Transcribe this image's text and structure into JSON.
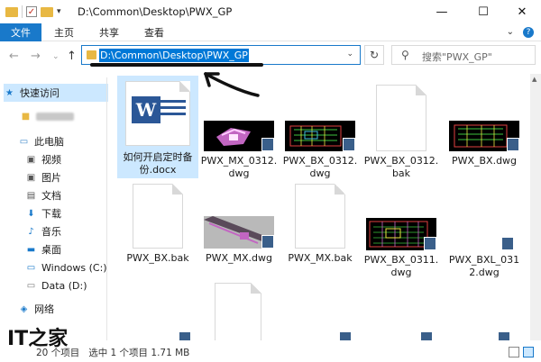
{
  "window": {
    "title": "D:\\Common\\Desktop\\PWX_GP",
    "controls": {
      "minimize": "—",
      "maximize": "☐",
      "close": "✕"
    }
  },
  "ribbon": {
    "tabs": [
      {
        "label": "文件",
        "active": true
      },
      {
        "label": "主页",
        "active": false
      },
      {
        "label": "共享",
        "active": false
      },
      {
        "label": "查看",
        "active": false
      }
    ],
    "expand": "⌄",
    "help": "?"
  },
  "nav": {
    "back": "←",
    "forward": "→",
    "recent": "⌄",
    "up": "↑",
    "address": "D:\\Common\\Desktop\\PWX_GP",
    "address_dropdown": "⌄",
    "refresh": "↻",
    "search_placeholder": "搜索\"PWX_GP\""
  },
  "sidebar": {
    "items": [
      {
        "label": "快速访问",
        "icon": "star-icon",
        "active": true
      },
      {
        "label": "",
        "icon": "user-icon",
        "active": false
      },
      {
        "label": "此电脑",
        "icon": "computer-icon",
        "active": false
      },
      {
        "label": "视频",
        "icon": "video-folder-icon",
        "active": false
      },
      {
        "label": "图片",
        "icon": "pictures-folder-icon",
        "active": false
      },
      {
        "label": "文档",
        "icon": "documents-folder-icon",
        "active": false
      },
      {
        "label": "下载",
        "icon": "download-icon",
        "active": false
      },
      {
        "label": "音乐",
        "icon": "music-icon",
        "active": false
      },
      {
        "label": "桌面",
        "icon": "desktop-icon",
        "active": false
      },
      {
        "label": "Windows (C:)",
        "icon": "drive-c-icon",
        "active": false
      },
      {
        "label": "Data (D:)",
        "icon": "drive-d-icon",
        "active": false
      },
      {
        "label": "网络",
        "icon": "network-icon",
        "active": false
      }
    ]
  },
  "files": [
    {
      "name": "如何开启定时备份.docx",
      "type": "docx",
      "selected": true
    },
    {
      "name": "PWX_MX_0312.dwg",
      "type": "dwg",
      "selected": false
    },
    {
      "name": "PWX_BX_0312.dwg",
      "type": "dwg",
      "selected": false
    },
    {
      "name": "PWX_BX_0312.bak",
      "type": "bak",
      "selected": false
    },
    {
      "name": "PWX_BX.dwg",
      "type": "dwg",
      "selected": false
    },
    {
      "name": "PWX_BX.bak",
      "type": "bak",
      "selected": false
    },
    {
      "name": "PWX_MX.dwg",
      "type": "dwg",
      "selected": false
    },
    {
      "name": "PWX_MX.bak",
      "type": "bak",
      "selected": false
    },
    {
      "name": "PWX_BX_0311.dwg",
      "type": "dwg",
      "selected": false
    },
    {
      "name": "PWX_BXL_0312.dwg",
      "type": "dwg",
      "selected": false
    }
  ],
  "status": {
    "count": "20 个项目",
    "selection": "选中 1 个项目 1.71 MB"
  },
  "watermark": "IT之家",
  "colors": {
    "accent": "#1979ca",
    "selection": "#cce8ff",
    "folder": "#e8b843",
    "word": "#2b5797"
  }
}
